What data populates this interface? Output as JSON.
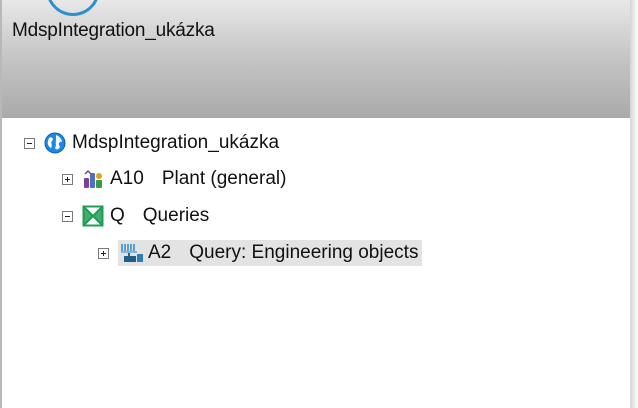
{
  "window": {
    "title": "MdspIntegration_ukázka"
  },
  "tree": {
    "root": {
      "label": "MdspIntegration_ukázka",
      "icon": "globe-icon",
      "expanded": true
    },
    "plant": {
      "code": "A10",
      "label": "Plant (general)",
      "icon": "plant-icon",
      "expanded": false
    },
    "queries": {
      "code": "Q",
      "label": "Queries",
      "icon": "queries-icon",
      "expanded": true
    },
    "query": {
      "code": "A2",
      "label": "Query: Engineering objects",
      "icon": "query-engineering-objects-icon",
      "expanded": false,
      "selected": true
    }
  },
  "colors": {
    "selection": "#e3e3e3",
    "globe_blue": "#1e88e5",
    "queries_green": "#1f9d55"
  }
}
